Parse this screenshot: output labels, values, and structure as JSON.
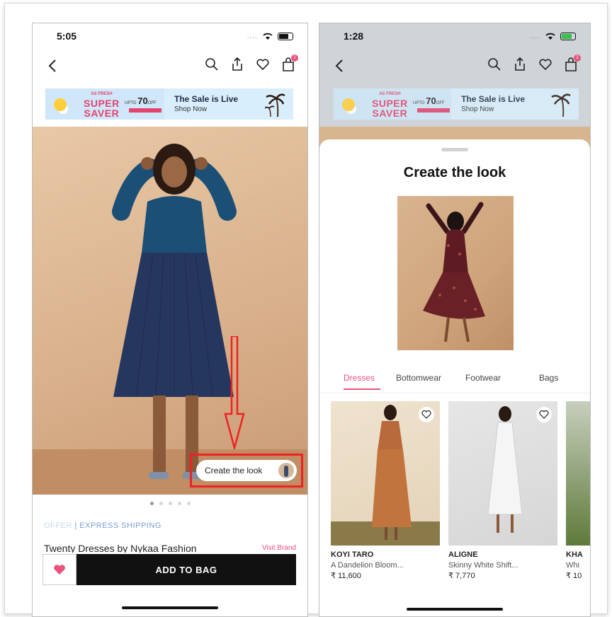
{
  "left_screen": {
    "status_time": "5:05",
    "status_dots": "....",
    "bag_count": "1",
    "banner": {
      "super_top": "AS FRESH",
      "super_word1": "SUPER",
      "super_word2": "SAVER",
      "upto": "UPTO",
      "discount": "70",
      "off": "OFF",
      "sale_title": "The Sale is Live",
      "sale_sub": "Shop Now"
    },
    "create_look_label": "Create the look",
    "offer_label": "OFFER",
    "separator": " | ",
    "shipping_label": "EXPRESS SHIPPING",
    "product_title": "Twenty Dresses by Nykaa Fashion",
    "visit_brand": "Visit Brand",
    "add_to_bag": "ADD TO BAG"
  },
  "right_screen": {
    "status_time": "1:28",
    "status_dots": "....",
    "bag_count": "1",
    "banner": {
      "super_top": "AS FRESH",
      "super_word1": "SUPER",
      "super_word2": "SAVER",
      "upto": "UPTO",
      "discount": "70",
      "off": "OFF",
      "sale_title": "The Sale is Live",
      "sale_sub": "Shop Now"
    },
    "sheet_title": "Create the look",
    "tabs": [
      {
        "label": "Dresses"
      },
      {
        "label": "Bottomwear"
      },
      {
        "label": "Footwear"
      },
      {
        "label": "Bags"
      }
    ],
    "products": [
      {
        "brand": "KOYI TARO",
        "name": "A Dandelion Bloom...",
        "price": "₹ 11,600"
      },
      {
        "brand": "ALIGNE",
        "name": "Skinny White Shift...",
        "price": "₹ 7,770"
      },
      {
        "brand": "KHA",
        "name": "Whi",
        "price": "₹ 10"
      }
    ]
  },
  "colors": {
    "accent": "#e8527c",
    "annotation": "#e22222",
    "button_bg": "#111111"
  }
}
